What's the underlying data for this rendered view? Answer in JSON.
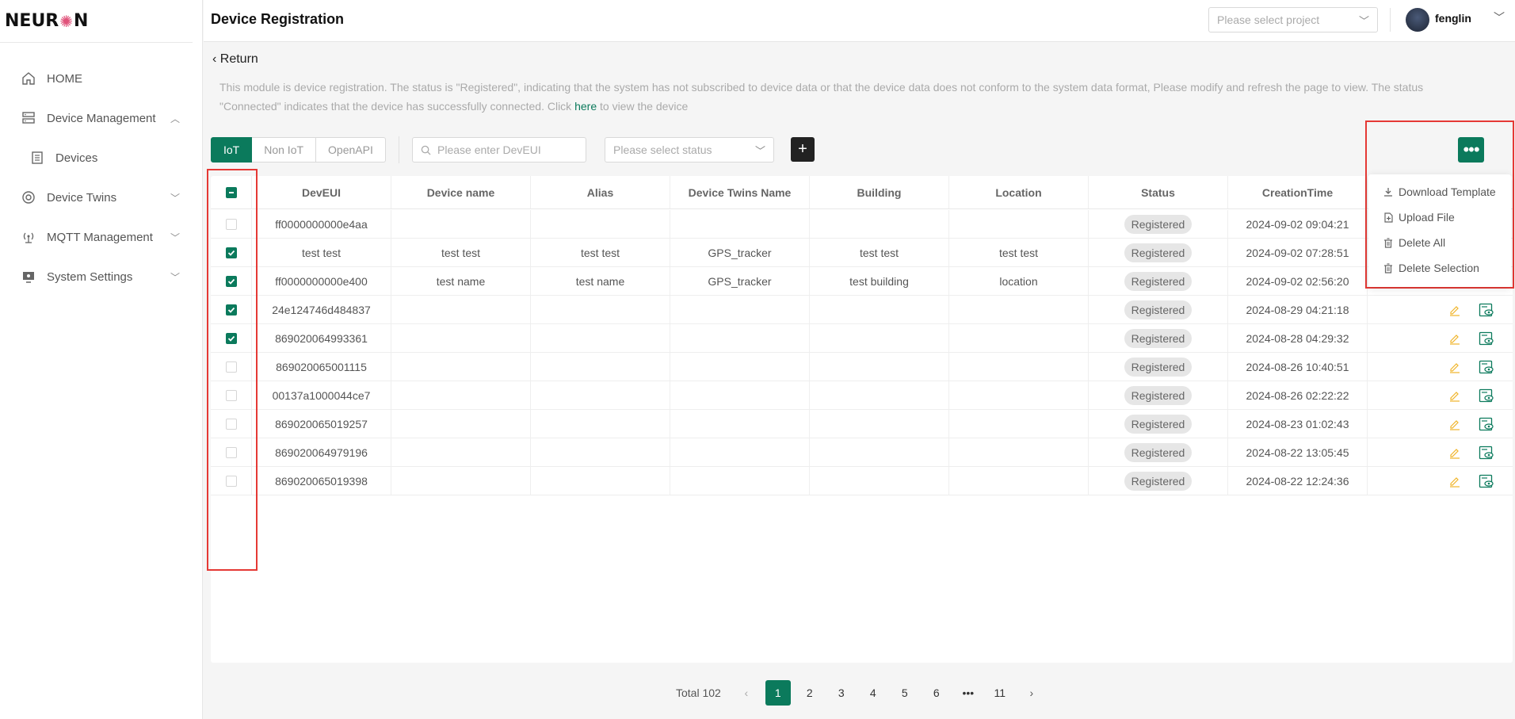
{
  "brand": {
    "logo_text_left": "NEUR",
    "logo_text_right": "N"
  },
  "sidebar": {
    "items": [
      {
        "label": "HOME",
        "icon": "home-icon",
        "chevron": ""
      },
      {
        "label": "Device Management",
        "icon": "server-icon",
        "chevron": "︿"
      },
      {
        "label": "Devices",
        "icon": "device-list-icon",
        "chevron": ""
      },
      {
        "label": "Device Twins",
        "icon": "twins-icon",
        "chevron": "﹀"
      },
      {
        "label": "MQTT Management",
        "icon": "antenna-icon",
        "chevron": "﹀"
      },
      {
        "label": "System Settings",
        "icon": "monitor-icon",
        "chevron": "﹀"
      }
    ]
  },
  "header": {
    "title": "Device Registration",
    "project_placeholder": "Please select project",
    "username": "fenglin"
  },
  "return_label": "Return",
  "description": {
    "text": "This module is device registration. The status is \"Registered\", indicating that the system has not subscribed to device data or that the device data does not conform to the system data format, Please modify and refresh the page to view. The status \"Connected\" indicates that the device has successfully connected. Click ",
    "link": "here",
    "suffix": " to view the device"
  },
  "toolbar": {
    "tabs": [
      "IoT",
      "Non IoT",
      "OpenAPI"
    ],
    "active_tab": "IoT",
    "search_placeholder": "Please enter DevEUI",
    "status_placeholder": "Please select status",
    "add_label": "+",
    "more_label": "•••"
  },
  "dropdown": {
    "items": [
      {
        "label": "Download Template",
        "icon": "download-icon"
      },
      {
        "label": "Upload File",
        "icon": "file-icon"
      },
      {
        "label": "Delete All",
        "icon": "trash-icon"
      },
      {
        "label": "Delete Selection",
        "icon": "trash-icon"
      }
    ]
  },
  "table": {
    "columns": [
      "DevEUI",
      "Device name",
      "Alias",
      "Device Twins Name",
      "Building",
      "Location",
      "Status",
      "CreationTime"
    ],
    "rows": [
      {
        "checked": false,
        "deveui": "ff0000000000e4aa",
        "name": "",
        "alias": "",
        "twins": "",
        "building": "",
        "location": "",
        "status": "Registered",
        "time": "2024-09-02 09:04:21"
      },
      {
        "checked": true,
        "deveui": "test test",
        "name": "test test",
        "alias": "test test",
        "twins": "GPS_tracker",
        "building": "test test",
        "location": "test test",
        "status": "Registered",
        "time": "2024-09-02 07:28:51"
      },
      {
        "checked": true,
        "deveui": "ff0000000000e400",
        "name": "test name",
        "alias": "test name",
        "twins": "GPS_tracker",
        "building": "test building",
        "location": "location",
        "status": "Registered",
        "time": "2024-09-02 02:56:20"
      },
      {
        "checked": true,
        "deveui": "24e124746d484837",
        "name": "",
        "alias": "",
        "twins": "",
        "building": "",
        "location": "",
        "status": "Registered",
        "time": "2024-08-29 04:21:18"
      },
      {
        "checked": true,
        "deveui": "869020064993361",
        "name": "",
        "alias": "",
        "twins": "",
        "building": "",
        "location": "",
        "status": "Registered",
        "time": "2024-08-28 04:29:32"
      },
      {
        "checked": false,
        "deveui": "869020065001115",
        "name": "",
        "alias": "",
        "twins": "",
        "building": "",
        "location": "",
        "status": "Registered",
        "time": "2024-08-26 10:40:51"
      },
      {
        "checked": false,
        "deveui": "00137a1000044ce7",
        "name": "",
        "alias": "",
        "twins": "",
        "building": "",
        "location": "",
        "status": "Registered",
        "time": "2024-08-26 02:22:22"
      },
      {
        "checked": false,
        "deveui": "869020065019257",
        "name": "",
        "alias": "",
        "twins": "",
        "building": "",
        "location": "",
        "status": "Registered",
        "time": "2024-08-23 01:02:43"
      },
      {
        "checked": false,
        "deveui": "869020064979196",
        "name": "",
        "alias": "",
        "twins": "",
        "building": "",
        "location": "",
        "status": "Registered",
        "time": "2024-08-22 13:05:45"
      },
      {
        "checked": false,
        "deveui": "869020065019398",
        "name": "",
        "alias": "",
        "twins": "",
        "building": "",
        "location": "",
        "status": "Registered",
        "time": "2024-08-22 12:24:36"
      }
    ]
  },
  "pagination": {
    "total_label": "Total 102",
    "pages": [
      "1",
      "2",
      "3",
      "4",
      "5",
      "6",
      "•••",
      "11"
    ],
    "current": "1"
  },
  "colors": {
    "accent": "#0b7a5c",
    "highlight": "#e53935",
    "edit_icon": "#f0b429"
  }
}
